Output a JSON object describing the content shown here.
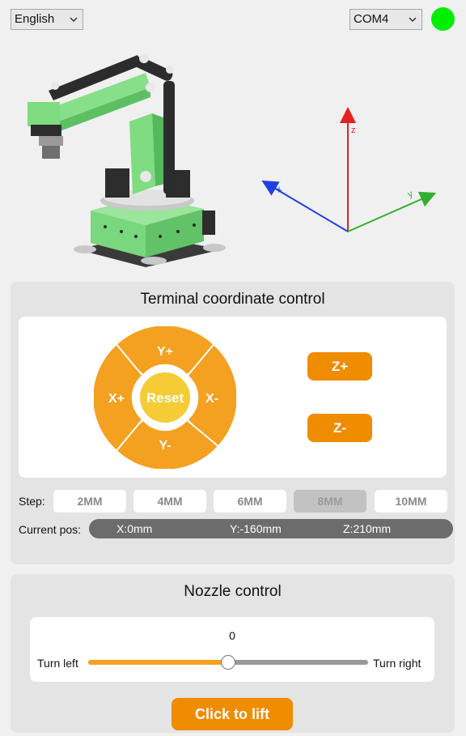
{
  "header": {
    "language": "English",
    "port": "COM4",
    "connection_color": "#00ef00"
  },
  "axes": {
    "z": "z",
    "x": "x",
    "y": "y"
  },
  "terminal": {
    "title": "Terminal coordinate control",
    "dpad": {
      "y_plus": "Y+",
      "y_minus": "Y-",
      "x_plus": "X+",
      "x_minus": "X-",
      "reset": "Reset"
    },
    "z_plus": "Z+",
    "z_minus": "Z-",
    "step_label": "Step:",
    "steps": [
      "2MM",
      "4MM",
      "6MM",
      "8MM",
      "10MM"
    ],
    "active_step": "8MM",
    "pos_label": "Current pos:",
    "pos": {
      "x": "X:0mm",
      "y": "Y:-160mm",
      "z": "Z:210mm"
    }
  },
  "nozzle": {
    "title": "Nozzle control",
    "value": "0",
    "left_label": "Turn left",
    "right_label": "Turn right",
    "slider_level": 0.5,
    "lift_button": "Click to lift"
  },
  "colors": {
    "accent": "#f08c00",
    "dpad_orange": "#f4a020",
    "reset_yellow": "#f5cc35",
    "panel": "#e4e4e4"
  }
}
